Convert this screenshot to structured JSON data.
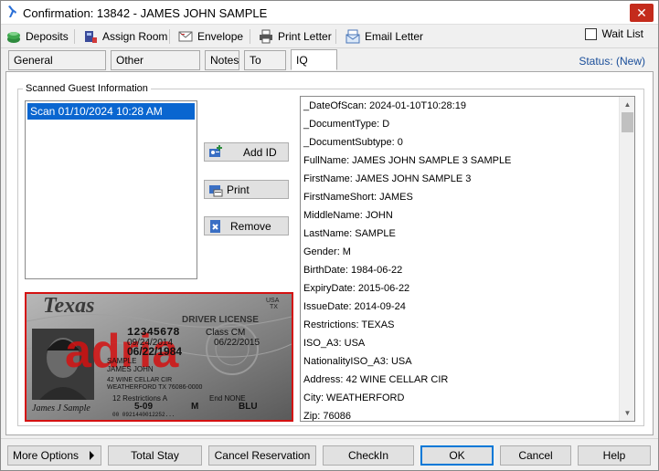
{
  "window": {
    "title": "Confirmation: 13842 - JAMES JOHN SAMPLE",
    "close_glyph": "✕"
  },
  "toolbar": {
    "deposits": "Deposits",
    "assign_room": "Assign Room",
    "envelope": "Envelope",
    "print_letter": "Print Letter",
    "email_letter": "Email Letter",
    "wait_list": "Wait List",
    "wait_list_checked": false
  },
  "tabs": [
    {
      "label": "General Information",
      "active": false
    },
    {
      "label": "Other Information",
      "active": false
    },
    {
      "label": "Notes",
      "active": false
    },
    {
      "label": "To Do's",
      "active": false
    },
    {
      "label": "IQ Scan",
      "active": true
    }
  ],
  "status": "Status: (New)",
  "scanned": {
    "group_title": "Scanned Guest Information",
    "items": [
      "Scan 01/10/2024 10:28 AM"
    ],
    "selected_index": 0
  },
  "actions": {
    "add_id": "Add ID",
    "print": "Print",
    "remove": "Remove"
  },
  "id_card": {
    "state": "Texas",
    "header": "DRIVER LICENSE",
    "license_number": "12345678",
    "class": "Class CM",
    "iss": "09/24/2014",
    "exp": "06/22/2015",
    "dob": "06/22/1984",
    "last_name": "SAMPLE",
    "first_name": "JAMES JOHN",
    "address1": "42 WINE CELLAR CIR",
    "address2": "WEATHERFORD TX 76086-0000",
    "restrictions": "12 Restrictions A",
    "end": "End NONE",
    "height": "5-09",
    "sex": "M",
    "eyes": "BLU",
    "dd": "00 0921440012252...",
    "signature": "James J Sample",
    "watermark": "adria",
    "usa": "USA",
    "tx": "TX"
  },
  "attributes": [
    "_DateOfScan: 2024-01-10T10:28:19",
    "_DocumentType: D",
    "_DocumentSubtype: 0",
    "FullName: JAMES JOHN SAMPLE 3 SAMPLE",
    "FirstName: JAMES JOHN SAMPLE 3",
    "FirstNameShort: JAMES",
    "MiddleName: JOHN",
    "LastName: SAMPLE",
    "Gender: M",
    "BirthDate: 1984-06-22",
    "ExpiryDate: 2015-06-22",
    "IssueDate: 2014-09-24",
    "Restrictions: TEXAS",
    "ISO_A3: USA",
    "NationalityISO_A3: USA",
    "Address: 42 WINE CELLAR CIR",
    "City: WEATHERFORD",
    "Zip: 76086"
  ],
  "bottom": {
    "more_options": "More Options",
    "total_stay": "Total Stay",
    "cancel_reservation": "Cancel Reservation",
    "check_in": "CheckIn",
    "ok": "OK",
    "cancel": "Cancel",
    "help": "Help"
  },
  "colors": {
    "selection": "#0a66d0",
    "status_text": "#1a4e9a",
    "card_border": "#d41111",
    "close_button": "#c42b1c"
  }
}
